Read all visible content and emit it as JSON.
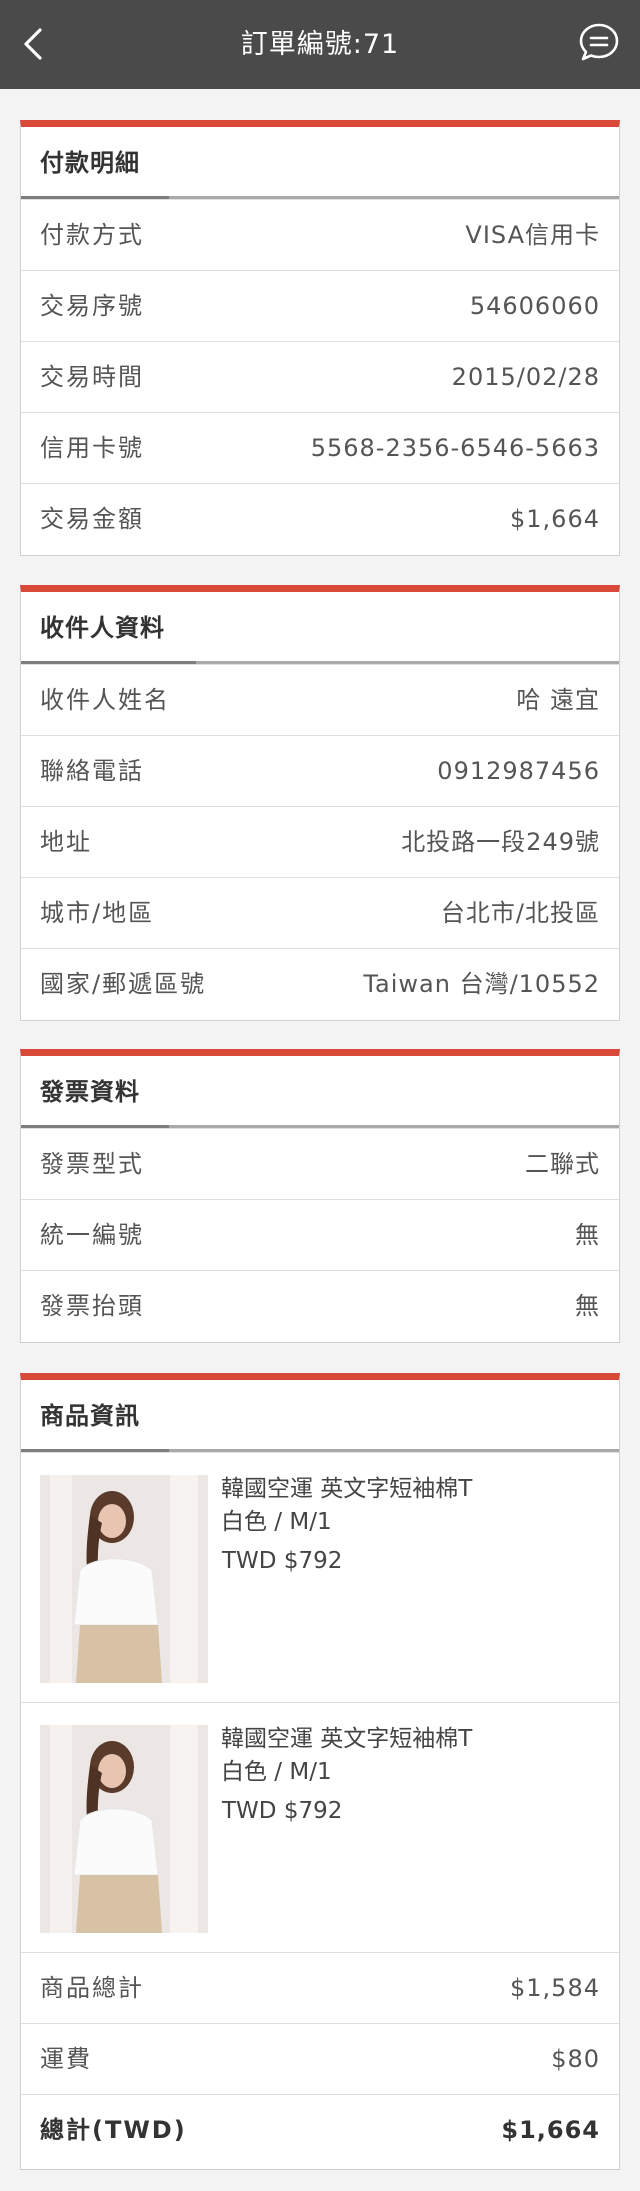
{
  "header": {
    "title": "訂單編號:71",
    "back_icon": "chevron-left-icon",
    "message_icon": "chat-bubble-icon"
  },
  "colors": {
    "accent": "#d9493a",
    "topbar": "#4a4a4a"
  },
  "payment": {
    "title": "付款明細",
    "rows": [
      {
        "label": "付款方式",
        "value": "VISA信用卡"
      },
      {
        "label": "交易序號",
        "value": "54606060"
      },
      {
        "label": "交易時間",
        "value": "2015/02/28"
      },
      {
        "label": "信用卡號",
        "value": "5568-2356-6546-5663"
      },
      {
        "label": "交易金額",
        "value": "$1,664"
      }
    ]
  },
  "recipient": {
    "title": "收件人資料",
    "rows": [
      {
        "label": "收件人姓名",
        "value": "哈 遠宜"
      },
      {
        "label": "聯絡電話",
        "value": "0912987456"
      },
      {
        "label": "地址",
        "value": "北投路一段249號"
      },
      {
        "label": "城市/地區",
        "value": "台北市/北投區"
      },
      {
        "label": "國家/郵遞區號",
        "value": "Taiwan 台灣/10552"
      }
    ]
  },
  "invoice": {
    "title": "發票資料",
    "rows": [
      {
        "label": "發票型式",
        "value": "二聯式"
      },
      {
        "label": "統一編號",
        "value": "無"
      },
      {
        "label": "發票抬頭",
        "value": "無"
      }
    ]
  },
  "products": {
    "title": "商品資訊",
    "items": [
      {
        "name": "韓國空運 英文字短袖棉T",
        "spec": "白色 / M/1",
        "price": "TWD $792"
      },
      {
        "name": "韓國空運 英文字短袖棉T",
        "spec": "白色 / M/1",
        "price": "TWD $792"
      }
    ],
    "summary": [
      {
        "label": "商品總計",
        "value": "$1,584"
      },
      {
        "label": "運費",
        "value": "$80"
      },
      {
        "label": "總計(TWD)",
        "value": "$1,664"
      }
    ]
  }
}
